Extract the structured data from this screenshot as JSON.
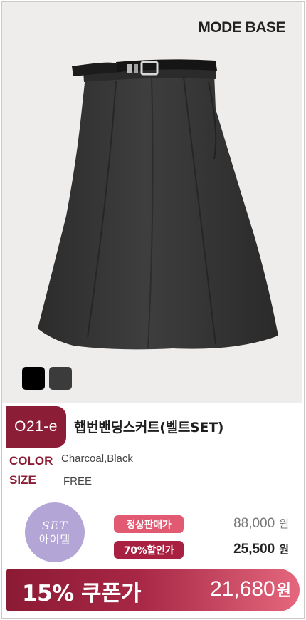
{
  "brand": {
    "name": "MODE BASE"
  },
  "product": {
    "code": "O21-e",
    "name": "햅번밴딩스커트(벨트SET)",
    "image_icon": "skirt-icon",
    "swatches": [
      {
        "name": "black",
        "color": "#000000"
      },
      {
        "name": "charcoal",
        "color": "#3b3b3b"
      }
    ]
  },
  "attributes": {
    "color_label": "COLOR",
    "color_value": "Charcoal,Black",
    "size_label": "SIZE",
    "size_value": "FREE"
  },
  "set_badge": {
    "line1": "SET",
    "line2": "아이템"
  },
  "pricing": {
    "normal_label": "정상판매가",
    "normal_price": "88,000",
    "sale_label": "70%할인가",
    "sale_price": "25,500",
    "currency": "원"
  },
  "coupon": {
    "label": "15% 쿠폰가",
    "price": "21,680",
    "currency": "원"
  },
  "colors": {
    "accent": "#8b1e36",
    "pink": "#e25a72",
    "lavender": "#b3a6d7"
  }
}
